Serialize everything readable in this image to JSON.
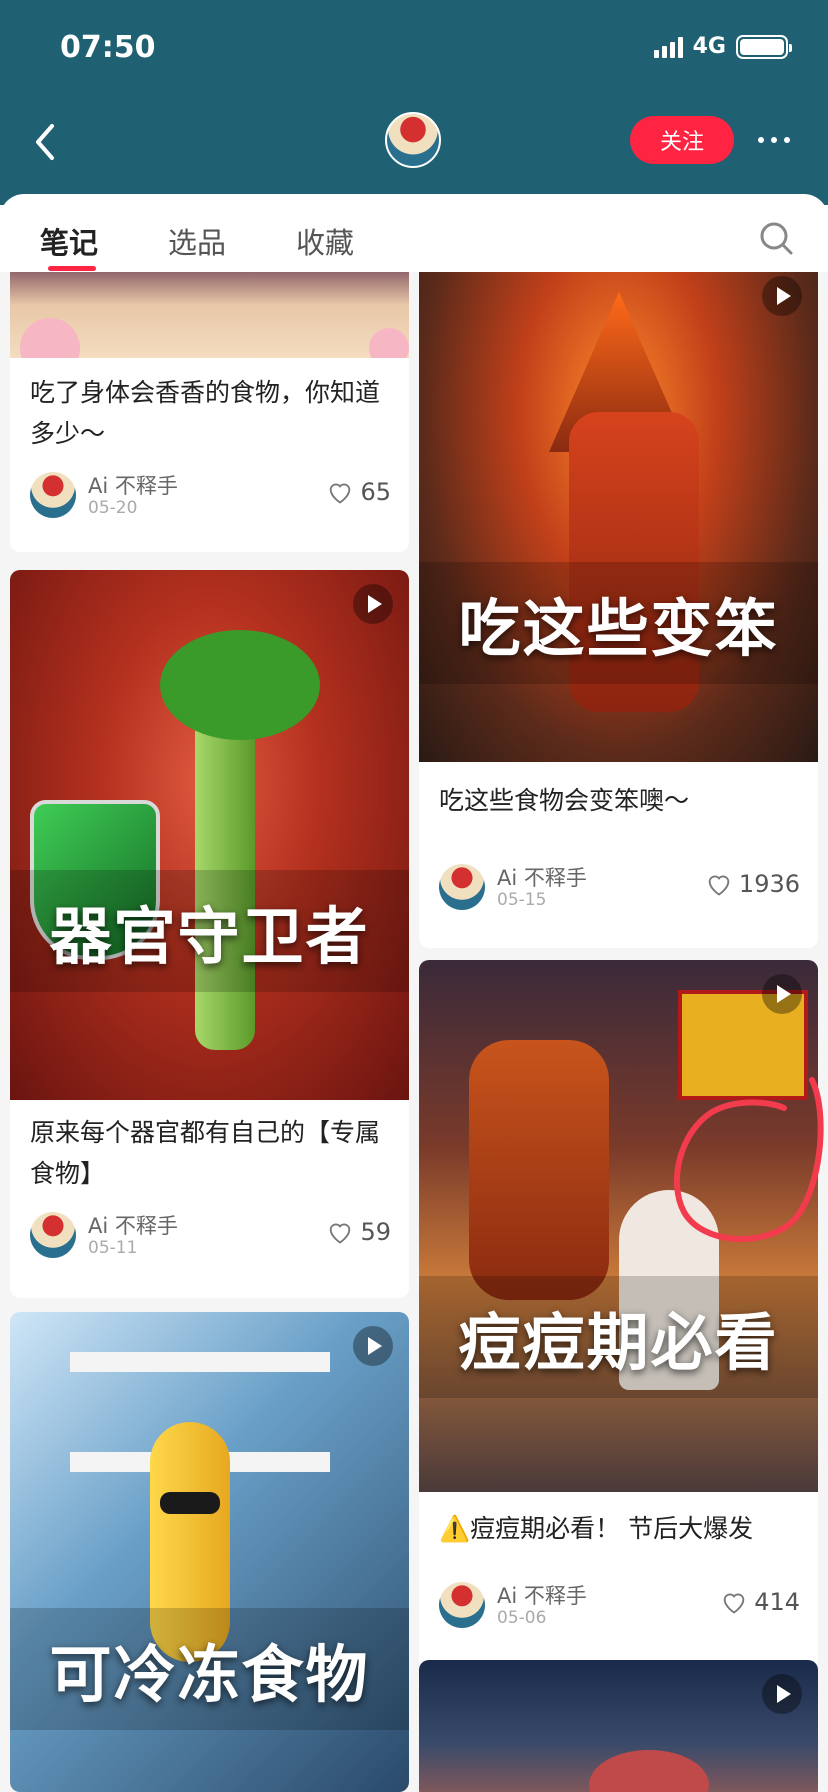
{
  "status_bar": {
    "time": "07:50",
    "network": "4G"
  },
  "header": {
    "follow_label": "关注"
  },
  "tabs": [
    {
      "label": "笔记",
      "active": true
    },
    {
      "label": "选品",
      "active": false
    },
    {
      "label": "收藏",
      "active": false
    }
  ],
  "notes": [
    {
      "title": "吃了身体会香香的食物，你知道多少～",
      "author": "Ai 不释手",
      "date": "05-20",
      "likes": "65",
      "cover_text": "",
      "video": false
    },
    {
      "title": "吃这些食物会变笨噢～",
      "author": "Ai 不释手",
      "date": "05-15",
      "likes": "1936",
      "cover_text": "吃这些变笨",
      "video": true
    },
    {
      "title": "原来每个器官都有自己的【专属食物】",
      "author": "Ai 不释手",
      "date": "05-11",
      "likes": "59",
      "cover_text": "器官守卫者",
      "video": true
    },
    {
      "title": "⚠️痘痘期必看！ 节后大爆发",
      "author": "Ai 不释手",
      "date": "05-06",
      "likes": "414",
      "cover_text": "痘痘期必看",
      "video": true
    },
    {
      "title": "",
      "author": "",
      "date": "",
      "likes": "",
      "cover_text": "可冷冻食物",
      "video": true
    },
    {
      "title": "",
      "author": "",
      "date": "",
      "likes": "",
      "cover_text": "",
      "video": true
    }
  ],
  "colors": {
    "header_bg": "#1f6173",
    "accent": "#ff2442",
    "annotation": "#f23b4c"
  }
}
